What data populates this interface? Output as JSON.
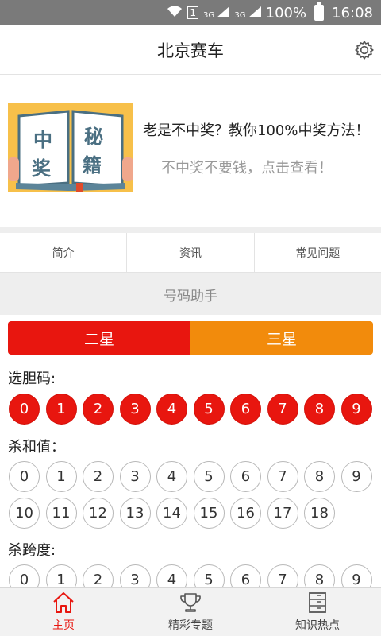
{
  "status": {
    "battery_percent": "100%",
    "time": "16:08",
    "sim": "1",
    "network": "3G"
  },
  "header": {
    "title": "北京赛车"
  },
  "banner": {
    "book_words": [
      "中",
      "奖",
      "秘",
      "籍"
    ],
    "headline": "老是不中奖？教你100%中奖方法！",
    "subline": "不中奖不要钱，点击查看！"
  },
  "tabs": [
    {
      "label": "简介"
    },
    {
      "label": "资讯"
    },
    {
      "label": "常见问题"
    }
  ],
  "section_title": "号码助手",
  "segments": [
    {
      "label": "二星"
    },
    {
      "label": "三星"
    }
  ],
  "groups": {
    "dan": {
      "label": "选胆码:",
      "numbers": [
        "0",
        "1",
        "2",
        "3",
        "4",
        "5",
        "6",
        "7",
        "8",
        "9"
      ]
    },
    "hezhi": {
      "label": "杀和值：",
      "numbers": [
        "0",
        "1",
        "2",
        "3",
        "4",
        "5",
        "6",
        "7",
        "8",
        "9",
        "10",
        "11",
        "12",
        "13",
        "14",
        "15",
        "16",
        "17",
        "18"
      ]
    },
    "kuadu": {
      "label": "杀跨度:",
      "numbers": [
        "0",
        "1",
        "2",
        "3",
        "4",
        "5",
        "6",
        "7",
        "8",
        "9"
      ]
    }
  },
  "bottom_nav": [
    {
      "label": "主页",
      "icon": "home-icon",
      "active": true
    },
    {
      "label": "精彩专题",
      "icon": "trophy-icon",
      "active": false
    },
    {
      "label": "知识热点",
      "icon": "list-icon",
      "active": false
    }
  ],
  "colors": {
    "accent_red": "#e8160f",
    "accent_orange": "#f28b0c"
  }
}
